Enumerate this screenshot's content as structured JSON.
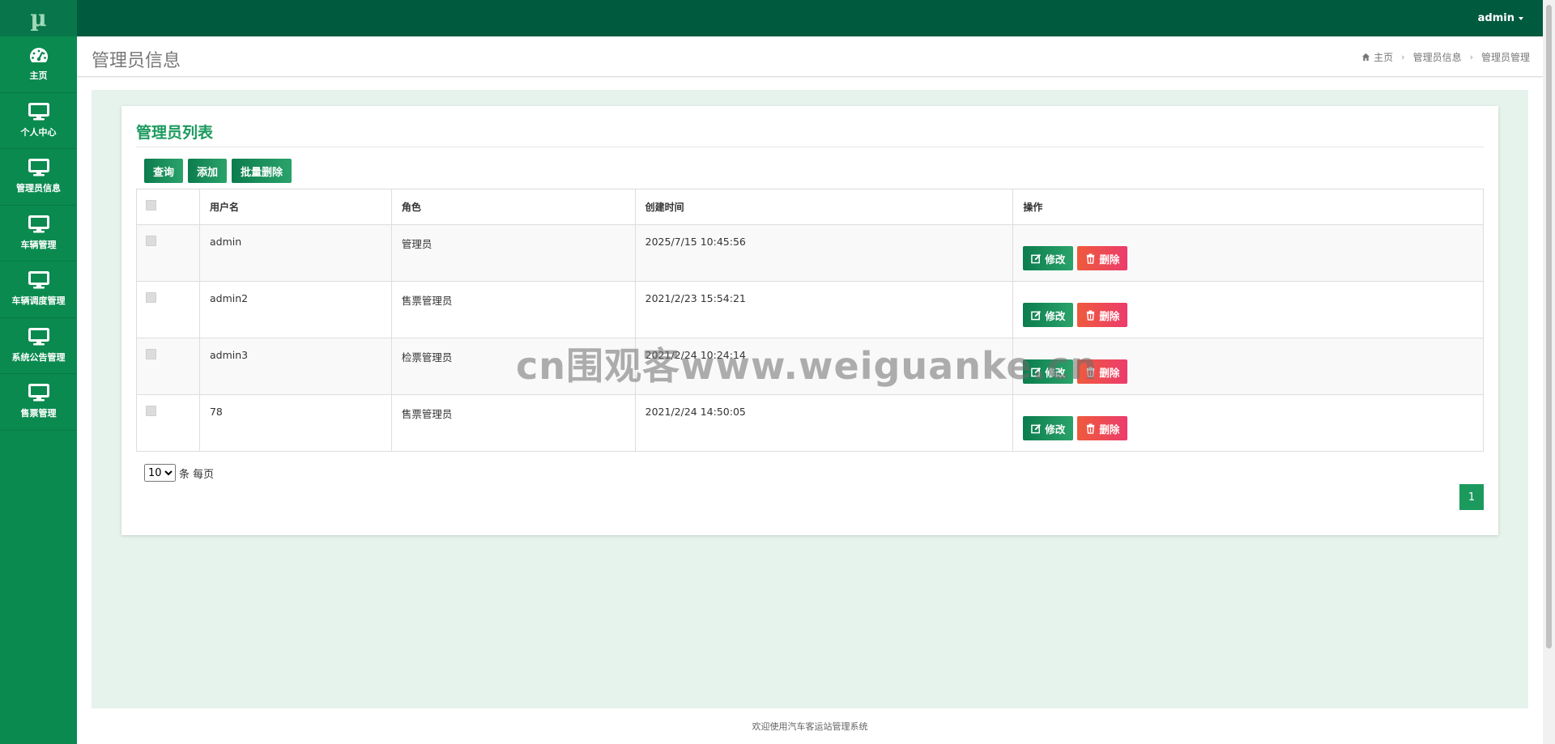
{
  "logo": "µ",
  "sidebar": {
    "items": [
      {
        "label": "主页",
        "icon": "dashboard-icon"
      },
      {
        "label": "个人中心",
        "icon": "monitor-icon"
      },
      {
        "label": "管理员信息",
        "icon": "monitor-icon"
      },
      {
        "label": "车辆管理",
        "icon": "monitor-icon"
      },
      {
        "label": "车辆调度管理",
        "icon": "monitor-icon"
      },
      {
        "label": "系统公告管理",
        "icon": "monitor-icon"
      },
      {
        "label": "售票管理",
        "icon": "monitor-icon"
      }
    ]
  },
  "topbar": {
    "user": "admin"
  },
  "header": {
    "title": "管理员信息",
    "breadcrumb": [
      "主页",
      "管理员信息",
      "管理员管理"
    ]
  },
  "panel": {
    "title": "管理员列表",
    "buttons": {
      "query": "查询",
      "add": "添加",
      "batch_delete": "批量删除"
    },
    "columns": [
      "用户名",
      "角色",
      "创建时间",
      "操作"
    ],
    "rows": [
      {
        "username": "admin",
        "role": "管理员",
        "created": "2025/7/15 10:45:56"
      },
      {
        "username": "admin2",
        "role": "售票管理员",
        "created": "2021/2/23 15:54:21"
      },
      {
        "username": "admin3",
        "role": "检票管理员",
        "created": "2021/2/24 10:24:14"
      },
      {
        "username": "78",
        "role": "售票管理员",
        "created": "2021/2/24 14:50:05"
      }
    ],
    "actions": {
      "edit": "修改",
      "delete": "删除"
    },
    "page_size": {
      "value": "10",
      "suffix": "条 每页"
    },
    "current_page": "1"
  },
  "footer": "欢迎使用汽车客运站管理系统",
  "watermark": "cn围观客www.weiguanke.cn",
  "colors": {
    "sidebar": "#0a8a4f",
    "topbar": "#005a3e",
    "accent": "#1c9a5e",
    "delete": "#ef4a50",
    "content_bg": "#e6f3ec"
  }
}
